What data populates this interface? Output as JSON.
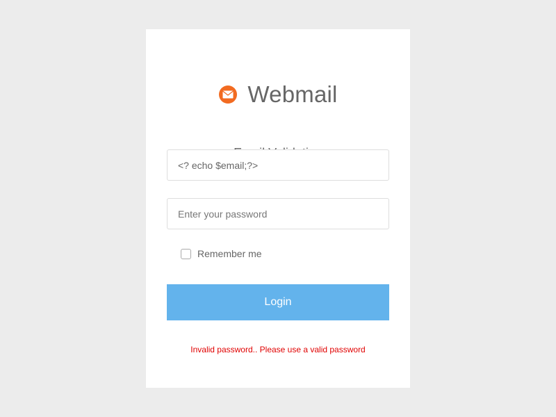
{
  "brand": {
    "title": "Webmail",
    "icon": "mail-envelope-icon",
    "icon_color": "#f26b21"
  },
  "form": {
    "heading": "Email Validation",
    "email_value": "<? echo $email;?>",
    "password_placeholder": "Enter your password",
    "password_value": "",
    "remember_label": "Remember me",
    "remember_checked": false,
    "login_label": "Login",
    "login_color": "#63b3ec",
    "error_message": "Invalid password.. Please use a valid password",
    "error_color": "#e00000"
  }
}
